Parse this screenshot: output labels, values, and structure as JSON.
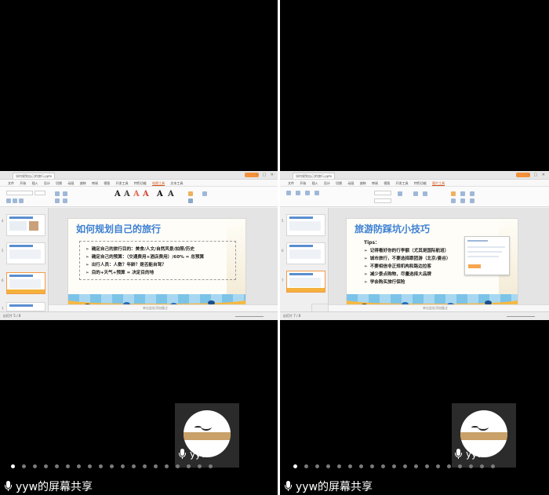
{
  "left_panel": {
    "doc_tab": "如何规划自己的旅行.pptx",
    "menu": [
      "文件",
      "开始",
      "插入",
      "设计",
      "切换",
      "动画",
      "放映",
      "审阅",
      "视图",
      "开发工具",
      "特色功能",
      "绘图工具",
      "文本工具"
    ],
    "slide": {
      "title": "如何规划自己的旅行",
      "bullets": [
        "确定自己的旅行目的：美食/人文/自然风景/拍照/历史",
        "确定自己的预算：（交通费用+酒店费用）/60% = 总预算",
        "出行人员：人数？年龄？是否能自驾？",
        "目的+天气+预算 = 决定目的地"
      ]
    },
    "notes_placeholder": "单击此处添加备注",
    "status_text": "幻灯片 5 / 8",
    "participant": "yyw"
  },
  "right_panel": {
    "doc_tab": "如何规划自己的旅行.pptx",
    "menu": [
      "文件",
      "开始",
      "插入",
      "设计",
      "切换",
      "动画",
      "放映",
      "审阅",
      "视图",
      "开发工具",
      "特色功能",
      "图片工具"
    ],
    "slide": {
      "title": "旅游防踩坑小技巧",
      "tips_label": "Tips：",
      "bullets": [
        "记得看好你的行李额（尤其是国际航班）",
        "城市旅行，不要选择跟团游（北京/曼谷）",
        "不要相信非正规机构和路边拉客",
        "减少景点购物，尽量选择大品牌",
        "学会购买旅行保险"
      ]
    },
    "notes_placeholder": "单击此处添加备注",
    "status_text": "幻灯片 7 / 8",
    "participant": "yyw"
  },
  "share_label": "yyw的屏幕共享",
  "pager_count": 19
}
